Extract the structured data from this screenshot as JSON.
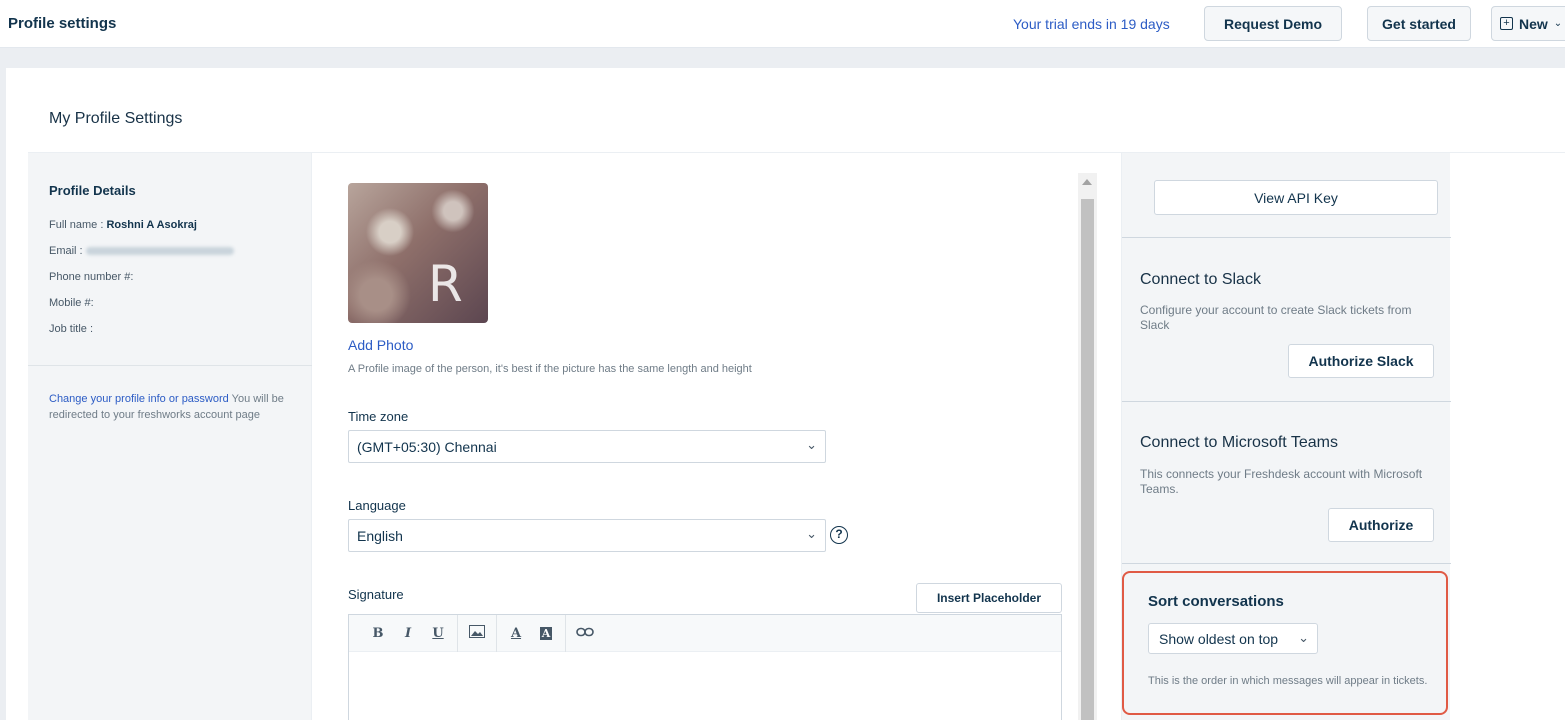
{
  "header": {
    "page_title": "Profile settings",
    "trial_text": "Your trial ends in 19 days",
    "request_demo_label": "Request Demo",
    "get_started_label": "Get started",
    "new_label": "New"
  },
  "card": {
    "title": "My Profile Settings"
  },
  "profile_details": {
    "title": "Profile Details",
    "full_name_label": "Full name : ",
    "full_name_value": "Roshni A Asokraj",
    "email_label": "Email : ",
    "phone_label": "Phone number #:",
    "mobile_label": "Mobile #:",
    "job_title_label": "Job title :",
    "change_link": "Change your profile info or password",
    "change_note": " You will be redirected to your freshworks account page"
  },
  "photo": {
    "avatar_letter": "R",
    "add_photo_label": "Add Photo",
    "hint": "A Profile image of the person, it's best if the picture has the same length and height"
  },
  "form": {
    "timezone_label": "Time zone",
    "timezone_value": "(GMT+05:30) Chennai",
    "language_label": "Language",
    "language_value": "English",
    "signature_label": "Signature",
    "insert_placeholder_label": "Insert Placeholder",
    "toolbar": {
      "bold": "B",
      "italic": "I",
      "underline": "U",
      "font_color": "A",
      "bg_color": "A"
    }
  },
  "right_panel": {
    "api_key_label": "View API Key",
    "slack_title": "Connect to Slack",
    "slack_desc": "Configure your account to create Slack tickets from Slack",
    "slack_button": "Authorize Slack",
    "teams_title": "Connect to Microsoft Teams",
    "teams_desc": "This connects your Freshdesk account with Microsoft Teams.",
    "teams_button": "Authorize",
    "sort_title": "Sort conversations",
    "sort_value": "Show oldest on top",
    "sort_desc": "This is the order in which messages will appear in tickets."
  },
  "colors": {
    "link": "#2c5cc5",
    "highlight_border": "#e05a45"
  }
}
